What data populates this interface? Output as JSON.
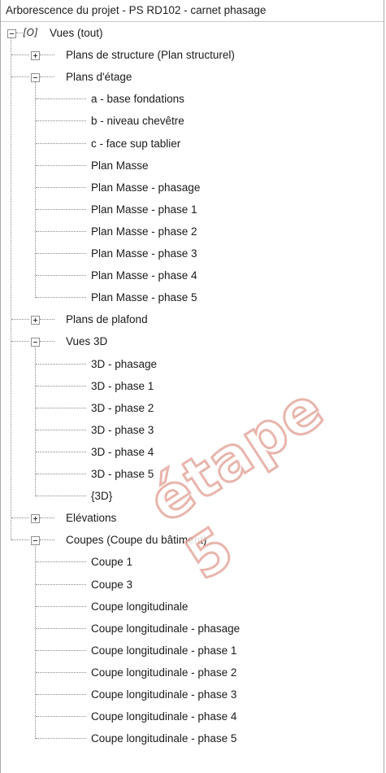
{
  "panel": {
    "title": "Arborescence du projet - PS RD102 - carnet phasage"
  },
  "tree": {
    "root": {
      "icon": "views-icon",
      "label": "Vues (tout)"
    },
    "nodes": [
      {
        "label": "Plans de structure (Plan structurel)",
        "level": 1,
        "toggle": "plus"
      },
      {
        "label": "Plans d'étage",
        "level": 1,
        "toggle": "minus"
      },
      {
        "label": "a - base fondations",
        "level": 2
      },
      {
        "label": "b - niveau chevêtre",
        "level": 2
      },
      {
        "label": "c - face sup tablier",
        "level": 2
      },
      {
        "label": "Plan Masse",
        "level": 2
      },
      {
        "label": "Plan Masse - phasage",
        "level": 2
      },
      {
        "label": "Plan Masse - phase 1",
        "level": 2
      },
      {
        "label": "Plan Masse - phase 2",
        "level": 2
      },
      {
        "label": "Plan Masse - phase 3",
        "level": 2
      },
      {
        "label": "Plan Masse - phase 4",
        "level": 2
      },
      {
        "label": "Plan Masse - phase 5",
        "level": 2
      },
      {
        "label": "Plans de plafond",
        "level": 1,
        "toggle": "plus"
      },
      {
        "label": "Vues 3D",
        "level": 1,
        "toggle": "minus"
      },
      {
        "label": "3D - phasage",
        "level": 2
      },
      {
        "label": "3D - phase 1",
        "level": 2
      },
      {
        "label": "3D - phase 2",
        "level": 2
      },
      {
        "label": "3D - phase 3",
        "level": 2
      },
      {
        "label": "3D - phase 4",
        "level": 2
      },
      {
        "label": "3D - phase 5",
        "level": 2
      },
      {
        "label": "{3D}",
        "level": 2
      },
      {
        "label": "Elévations",
        "level": 1,
        "toggle": "plus"
      },
      {
        "label": "Coupes (Coupe du bâtiment)",
        "level": 1,
        "toggle": "minus"
      },
      {
        "label": "Coupe 1",
        "level": 2
      },
      {
        "label": "Coupe 3",
        "level": 2
      },
      {
        "label": "Coupe longitudinale",
        "level": 2
      },
      {
        "label": "Coupe longitudinale - phasage",
        "level": 2
      },
      {
        "label": "Coupe longitudinale - phase 1",
        "level": 2
      },
      {
        "label": "Coupe longitudinale - phase 2",
        "level": 2
      },
      {
        "label": "Coupe longitudinale - phase 3",
        "level": 2
      },
      {
        "label": "Coupe longitudinale - phase 4",
        "level": 2
      },
      {
        "label": "Coupe longitudinale - phase 5",
        "level": 2
      }
    ]
  },
  "watermark": {
    "text": "étape 5"
  }
}
